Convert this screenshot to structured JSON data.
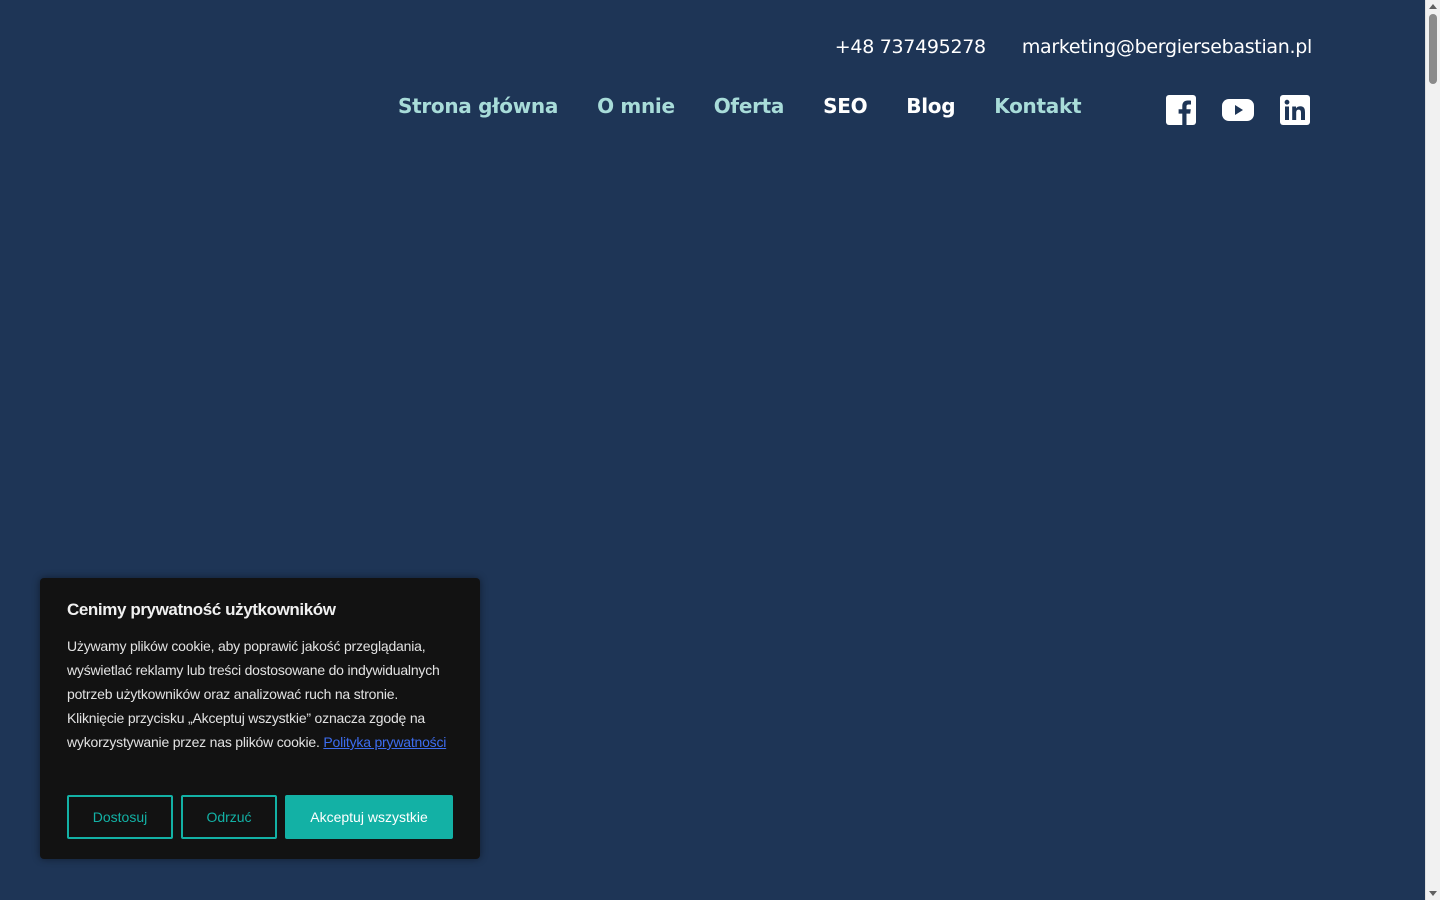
{
  "contact": {
    "phone": "+48 737495278",
    "email": "marketing@bergiersebastian.pl"
  },
  "nav": {
    "items": [
      {
        "label": "Strona główna"
      },
      {
        "label": "O mnie"
      },
      {
        "label": "Oferta"
      },
      {
        "label": "SEO"
      },
      {
        "label": "Blog"
      },
      {
        "label": "Kontakt"
      }
    ]
  },
  "social": {
    "icons": [
      "facebook-icon",
      "youtube-icon",
      "linkedin-icon"
    ]
  },
  "cookie": {
    "title": "Cenimy prywatność użytkowników",
    "text": "Używamy plików cookie, aby poprawić jakość przeglądania, wyświetlać reklamy lub treści dostosowane do indywidualnych potrzeb użytkowników oraz analizować ruch na stronie. Kliknięcie przycisku „Akceptuj wszystkie” oznacza zgodę na wykorzystywanie przez nas plików cookie.",
    "policy_link": "Polityka prywatności",
    "customize_label": "Dostosuj",
    "reject_label": "Odrzuć",
    "accept_label": "Akceptuj wszystkie"
  },
  "colors": {
    "background": "#1e3556",
    "nav_accent": "#a8dcd9",
    "button_teal": "#13b1a5",
    "banner_bg": "#121212",
    "link_blue": "#3d6df0"
  }
}
